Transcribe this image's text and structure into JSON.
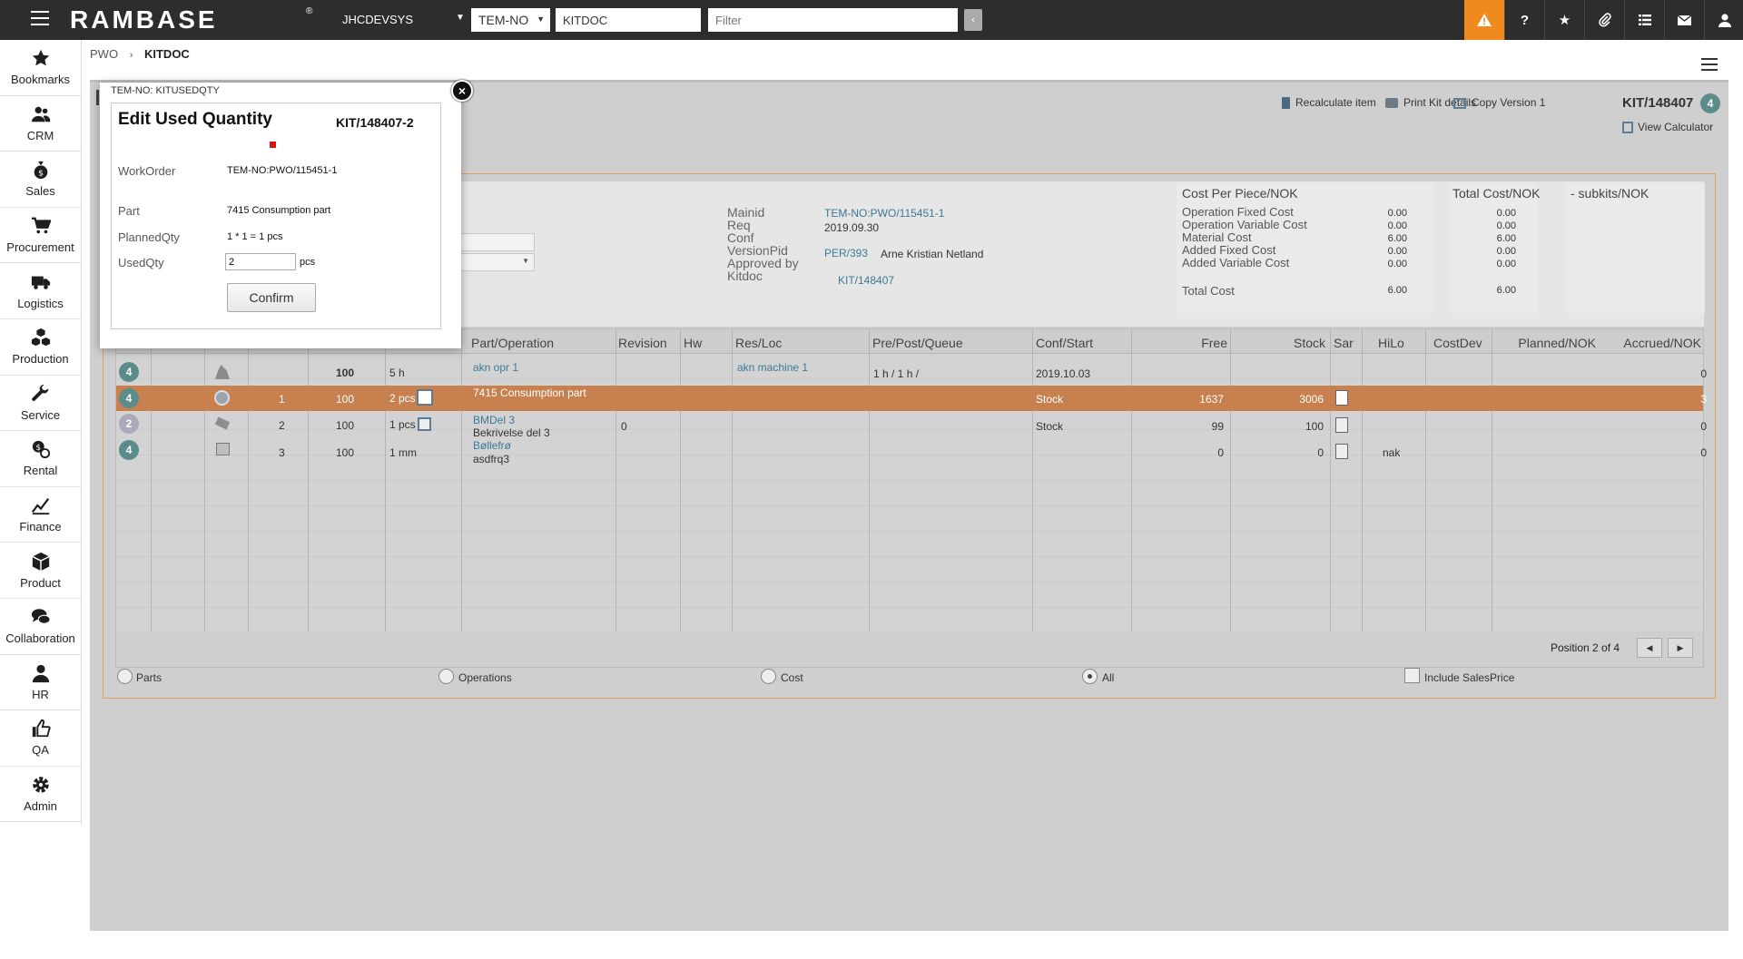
{
  "topbar": {
    "logo": "RAMBASE",
    "system": "JHCDEVSYS",
    "company": "TEM-NO",
    "program": "KITDOC",
    "filter_placeholder": "Filter"
  },
  "sidebar": {
    "items": [
      {
        "label": "Bookmarks",
        "icon": "star-icon"
      },
      {
        "label": "CRM",
        "icon": "users-icon"
      },
      {
        "label": "Sales",
        "icon": "money-bag-icon"
      },
      {
        "label": "Procurement",
        "icon": "cart-icon"
      },
      {
        "label": "Logistics",
        "icon": "truck-icon"
      },
      {
        "label": "Production",
        "icon": "cubes-icon"
      },
      {
        "label": "Service",
        "icon": "wrench-icon"
      },
      {
        "label": "Rental",
        "icon": "rental-icon"
      },
      {
        "label": "Finance",
        "icon": "chart-line-icon"
      },
      {
        "label": "Product",
        "icon": "cube-icon"
      },
      {
        "label": "Collaboration",
        "icon": "comments-icon"
      },
      {
        "label": "HR",
        "icon": "user-icon"
      },
      {
        "label": "QA",
        "icon": "thumbs-up-icon"
      },
      {
        "label": "Admin",
        "icon": "gear-icon"
      }
    ]
  },
  "breadcrumb": {
    "parent": "PWO",
    "current": "KITDOC"
  },
  "toolbar": {
    "recalculate": "Recalculate item",
    "print": "Print Kit details",
    "copy": "Copy Version 1",
    "doc_id": "KIT/148407",
    "doc_status": "4",
    "calculator": "View Calculator"
  },
  "info": {
    "labels": [
      "Mainid",
      "Req",
      "Conf",
      "VersionPid",
      "Approved by",
      "Kitdoc"
    ],
    "mainid": "TEM-NO:PWO/115451-1",
    "req": "2019.09.30",
    "versionpid": "PER/393",
    "approver": "Arne Kristian Netland",
    "kitdoc": "KIT/148407"
  },
  "cost_per_piece": {
    "title": "Cost Per Piece/NOK",
    "labels": [
      "Operation Fixed Cost",
      "Operation Variable Cost",
      "Material Cost",
      "Added Fixed Cost",
      "Added Variable Cost"
    ],
    "values": [
      "0.00",
      "0.00",
      "6.00",
      "0.00",
      "0.00"
    ],
    "total_label": "Total Cost",
    "total": "6.00"
  },
  "total_cost": {
    "title": "Total Cost/NOK",
    "values": [
      "0.00",
      "0.00",
      "6.00",
      "0.00",
      "0.00"
    ],
    "total": "6.00"
  },
  "subkits": {
    "title": "- subkits/NOK"
  },
  "table": {
    "headers": [
      "Part/Operation",
      "Revision",
      "Hw",
      "Res/Loc",
      "Pre/Post/Queue",
      "Conf/Start",
      "Free",
      "Stock",
      "Sar",
      "HiLo",
      "CostDev",
      "Planned/NOK",
      "Accrued/NOK"
    ],
    "rows": [
      {
        "status": "4",
        "seq": "",
        "pct": "100",
        "qty": "5 h",
        "part": "akn opr 1",
        "desc": "",
        "revision": "",
        "resloc": "akn machine 1",
        "queue": "1 h / 1 h /",
        "conf": "2019.10.03",
        "free": "",
        "stock": "",
        "hilo": "",
        "planned": "0"
      },
      {
        "status": "4",
        "seq": "1",
        "pct": "100",
        "qty": "2 pcs",
        "part": "7415 Consumption part",
        "desc": "",
        "revision": "",
        "resloc": "",
        "queue": "",
        "conf": "Stock",
        "free": "1637",
        "stock": "3006",
        "hilo": "",
        "planned": "3"
      },
      {
        "status": "2",
        "seq": "2",
        "pct": "100",
        "qty": "1 pcs",
        "part": "BMDel 3",
        "desc": "Bekrivelse del 3",
        "revision": "0",
        "resloc": "",
        "queue": "",
        "conf": "Stock",
        "free": "99",
        "stock": "100",
        "hilo": "",
        "planned": "0"
      },
      {
        "status": "4",
        "seq": "3",
        "pct": "100",
        "qty": "1 mm",
        "part": "Bøllefrø",
        "desc": "asdfrq3",
        "revision": "",
        "resloc": "",
        "queue": "",
        "conf": "",
        "free": "0",
        "stock": "0",
        "hilo": "nak",
        "planned": "0"
      }
    ],
    "partial_header_pct": "",
    "position": "Position 2 of 4"
  },
  "filters": {
    "parts": "Parts",
    "operations": "Operations",
    "cost": "Cost",
    "all": "All",
    "salesprice": "Include SalesPrice"
  },
  "popup": {
    "tag": "TEM-NO: KITUSEDQTY",
    "title": "Edit Used Quantity",
    "doc": "KIT/148407-2",
    "workorder_label": "WorkOrder",
    "workorder": "TEM-NO:PWO/115451-1",
    "part_label": "Part",
    "part": "7415 Consumption part",
    "planned_label": "PlannedQty",
    "planned": "1 * 1 = 1 pcs",
    "used_label": "UsedQty",
    "used": "2",
    "unit": "pcs",
    "confirm": "Confirm"
  },
  "colors": {
    "accent": "#f08a1c",
    "selected_row": "#c9804f",
    "topbar": "#2d2d2d",
    "link": "#3c7a97"
  }
}
